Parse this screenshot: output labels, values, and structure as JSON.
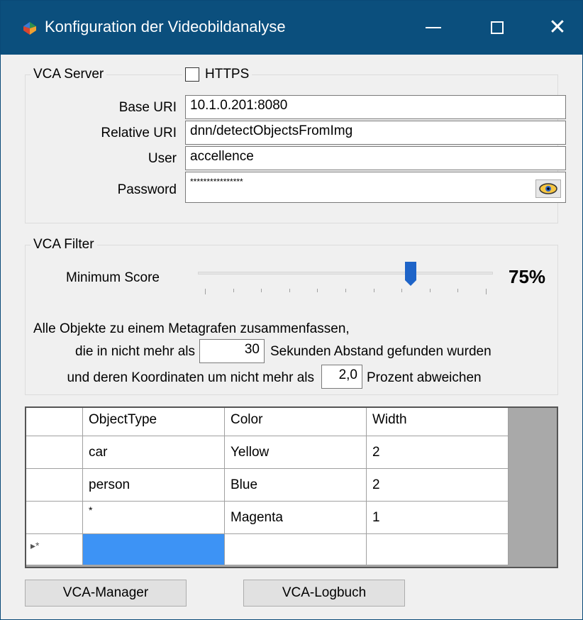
{
  "window": {
    "title": "Konfiguration der Videobildanalyse"
  },
  "server": {
    "legend": "VCA Server",
    "https_label": "HTTPS",
    "https_checked": false,
    "base_uri_label": "Base URI",
    "base_uri_value": "10.1.0.201:8080",
    "relative_uri_label": "Relative URI",
    "relative_uri_value": "dnn/detectObjectsFromImg",
    "user_label": "User",
    "user_value": "accellence",
    "password_label": "Password",
    "password_value": "****************"
  },
  "filter": {
    "legend": "VCA Filter",
    "min_score_label": "Minimum Score",
    "min_score_value": 0.75,
    "min_score_text": "75%",
    "line1": "Alle Objekte zu einem Metagrafen zusammenfassen,",
    "line2_before": "die in nicht mehr als",
    "seconds_value": "30",
    "line2_after": "Sekunden Abstand gefunden wurden",
    "line3_before": "und deren Koordinaten um nicht mehr als",
    "percent_value": "2,0",
    "line3_after": "Prozent abweichen"
  },
  "grid": {
    "columns": [
      "ObjectType",
      "Color",
      "Width"
    ],
    "rows": [
      [
        "car",
        "Yellow",
        "2"
      ],
      [
        "person",
        "Blue",
        "2"
      ],
      [
        "*",
        "Magenta",
        "1"
      ]
    ],
    "new_row_marker": "▸*"
  },
  "buttons": {
    "manager": "VCA-Manager",
    "logbook": "VCA-Logbuch"
  },
  "colors": {
    "titlebar": "#0b4f7d",
    "slider_thumb": "#1e64c8",
    "selection": "#3d93f5"
  }
}
